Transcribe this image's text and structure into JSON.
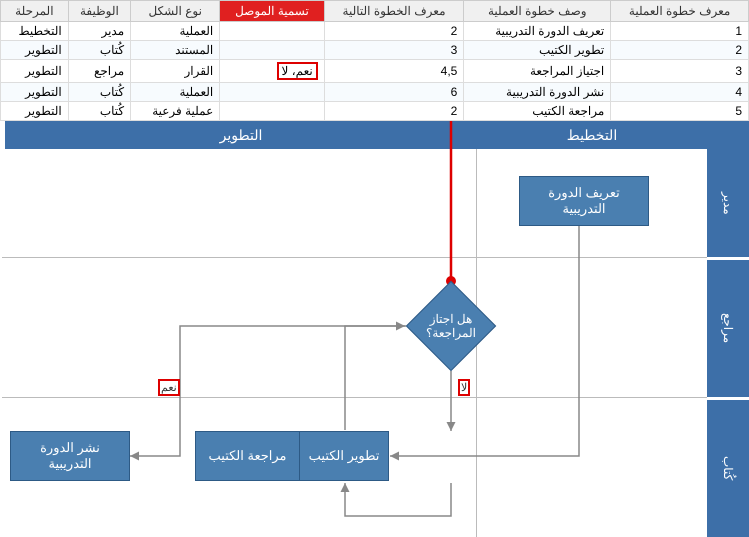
{
  "table": {
    "headers": {
      "step_id": "معرف خطوة العملية",
      "step_desc": "وصف خطوة العملية",
      "next_id": "معرف الخطوة التالية",
      "conn_label": "تسمية الموصل",
      "shape_type": "نوع الشكل",
      "role": "الوظيفة",
      "phase": "المرحلة"
    },
    "rows": [
      {
        "step_id": "1",
        "step_desc": "تعريف الدورة التدريبية",
        "next_id": "2",
        "conn_label": "",
        "shape_type": "العملية",
        "role": "مدير",
        "phase": "التخطيط"
      },
      {
        "step_id": "2",
        "step_desc": "تطوير الكتيب",
        "next_id": "3",
        "conn_label": "",
        "shape_type": "المستند",
        "role": "كُتاب",
        "phase": "التطوير"
      },
      {
        "step_id": "3",
        "step_desc": "اجتياز المراجعة",
        "next_id": "4,5",
        "conn_label": "نعم، لا",
        "shape_type": "القرار",
        "role": "مراجع",
        "phase": "التطوير"
      },
      {
        "step_id": "4",
        "step_desc": "نشر الدورة التدريبية",
        "next_id": "6",
        "conn_label": "",
        "shape_type": "العملية",
        "role": "كُتاب",
        "phase": "التطوير"
      },
      {
        "step_id": "5",
        "step_desc": "مراجعة الكتيب",
        "next_id": "2",
        "conn_label": "",
        "shape_type": "عملية فرعية",
        "role": "كُتاب",
        "phase": "التطوير"
      }
    ]
  },
  "phases": {
    "plan": "التخطيط",
    "dev": "التطوير"
  },
  "roles": {
    "r1": "مدير",
    "r2": "مراجع",
    "r3": "كُتاب"
  },
  "nodes": {
    "define_course": "تعريف الدورة التدريبية",
    "develop_booklet": "تطوير الكتيب",
    "pass_review": "هل اجتاز المراجعة؟",
    "review_booklet": "مراجعة الكتيب",
    "publish_course": "نشر الدورة التدريبية"
  },
  "labels": {
    "yes": "نعم",
    "no": "لا"
  }
}
